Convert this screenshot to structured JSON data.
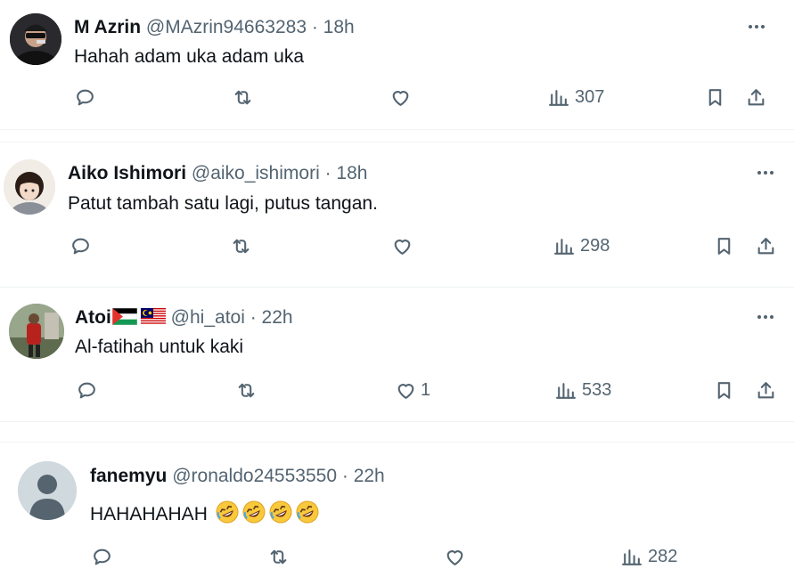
{
  "tweets": [
    {
      "name": "M Azrin",
      "handle": "@MAzrin94663283",
      "time": "18h",
      "text": "Hahah adam uka adam uka",
      "views": "307",
      "likes": ""
    },
    {
      "name": "Aiko Ishimori",
      "handle": "@aiko_ishimori",
      "time": "18h",
      "text": "Patut tambah satu lagi, putus tangan.",
      "views": "298",
      "likes": ""
    },
    {
      "name": "Atoi",
      "handle": "@hi_atoi",
      "time": "22h",
      "text": "Al-fatihah untuk kaki",
      "views": "533",
      "likes": "1",
      "flags": [
        "palestine-flag",
        "malaysia-flag"
      ]
    },
    {
      "name": "fanemyu",
      "handle": "@ronaldo24553550",
      "time": "22h",
      "text": "HAHAHAHAH",
      "views": "282",
      "likes": "",
      "emoji": "rolling-on-floor-laughing x4"
    }
  ],
  "separator": " · ",
  "colors": {
    "text": "#0f1419",
    "muted": "#536471",
    "divider": "#eff3f4"
  }
}
